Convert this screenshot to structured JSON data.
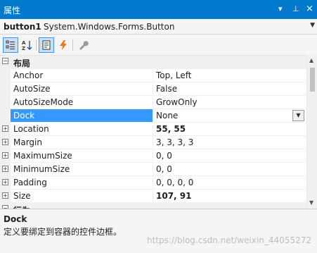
{
  "panel": {
    "title": "属性",
    "dropdown_glyph": "▾",
    "pin_glyph": "⊥",
    "close_glyph": "×"
  },
  "selector": {
    "object_name": "button1",
    "object_type": "System.Windows.Forms.Button"
  },
  "toolbar": {
    "buttons": [
      {
        "name": "categorized-icon",
        "active": true
      },
      {
        "name": "alphabetical-icon",
        "active": false
      },
      {
        "name": "properties-icon",
        "active": true
      },
      {
        "name": "events-icon",
        "active": false
      },
      {
        "name": "property-pages-icon",
        "active": false
      }
    ]
  },
  "grid": {
    "category_layout": "布局",
    "rows": [
      {
        "name": "Anchor",
        "value": "Top, Left"
      },
      {
        "name": "AutoSize",
        "value": "False"
      },
      {
        "name": "AutoSizeMode",
        "value": "GrowOnly"
      },
      {
        "name": "Dock",
        "value": "None"
      },
      {
        "name": "Location",
        "value": "55, 55"
      },
      {
        "name": "Margin",
        "value": "3, 3, 3, 3"
      },
      {
        "name": "MaximumSize",
        "value": "0, 0"
      },
      {
        "name": "MinimumSize",
        "value": "0, 0"
      },
      {
        "name": "Padding",
        "value": "0, 0, 0, 0"
      },
      {
        "name": "Size",
        "value": "107, 91"
      }
    ],
    "next_category": "行为"
  },
  "description": {
    "title": "Dock",
    "text": "定义要绑定到容器的控件边框。"
  },
  "watermark": "https://blog.csdn.net/weixin_44055272",
  "colors": {
    "accent": "#007acc",
    "selection": "#3399ff",
    "events_icon": "#e8791d"
  }
}
